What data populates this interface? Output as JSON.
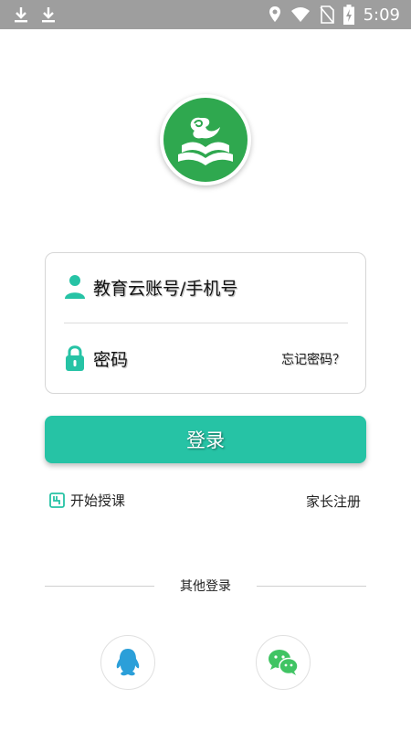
{
  "status_bar": {
    "time": "5:09",
    "icons": [
      "download-icon",
      "download-icon",
      "location-icon",
      "wifi-icon",
      "no-sim-icon",
      "battery-charging-icon"
    ]
  },
  "logo": {
    "icon": "cloud-book-logo",
    "color": "#2fa84f"
  },
  "login_form": {
    "account_placeholder": "教育云账号/手机号",
    "password_placeholder": "密码",
    "forgot_password": "忘记密码？"
  },
  "login_button": {
    "label": "登录",
    "color": "#26c3a5"
  },
  "links": {
    "start_teaching": "开始授课",
    "parent_register": "家长注册"
  },
  "other_login": {
    "label": "其他登录",
    "options": [
      {
        "name": "qq",
        "icon": "qq-penguin-icon",
        "color": "#2b9fd9"
      },
      {
        "name": "wechat",
        "icon": "wechat-icon",
        "color": "#40c463"
      }
    ]
  }
}
